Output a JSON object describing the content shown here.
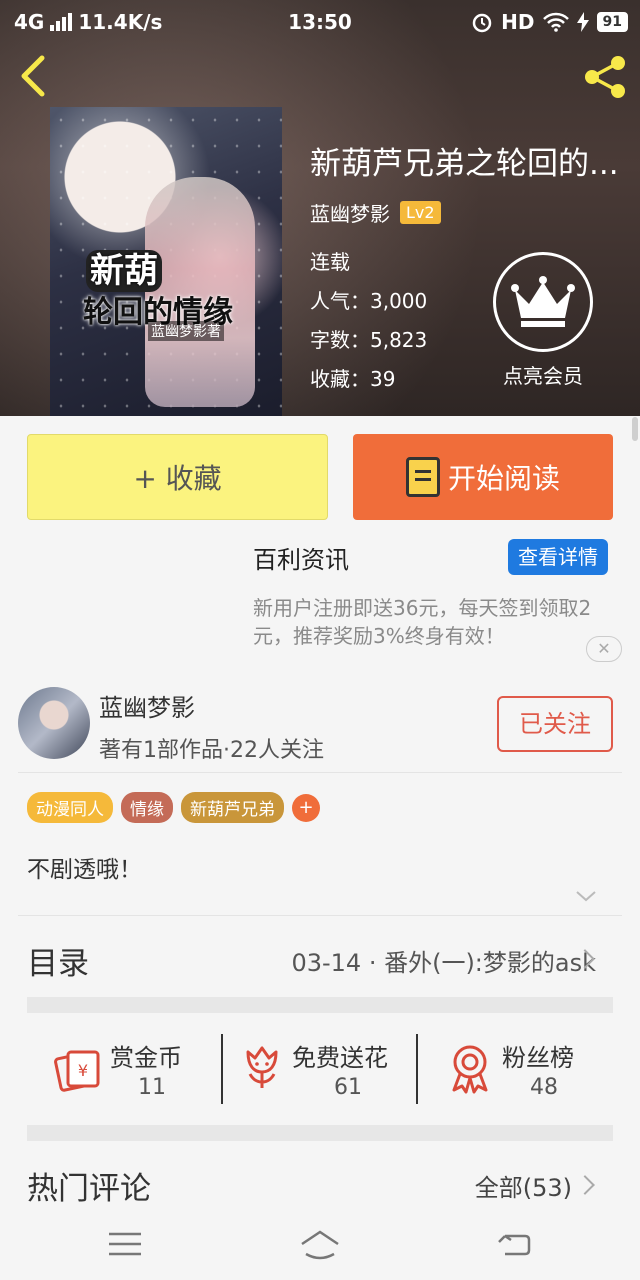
{
  "status_bar": {
    "network": "4G",
    "speed": "11.4K/s",
    "time": "13:50",
    "hd": "HD",
    "battery": "91"
  },
  "book": {
    "title": "新葫芦兄弟之轮回的...",
    "author": "蓝幽梦影",
    "level": "Lv2",
    "status": "连载",
    "popularity": "人气：3,000",
    "word_count": "字数：5,823",
    "favorites": "收藏：39",
    "cover_title_1": "新葫",
    "cover_title_2": "轮回的情缘",
    "cover_author": "蓝幽梦影著"
  },
  "vip": {
    "label": "点亮会员"
  },
  "actions": {
    "collect_label": "+ 收藏",
    "read_label": "开始阅读"
  },
  "ad": {
    "title": "百利资讯",
    "button": "查看详情",
    "description": "新用户注册即送36元，每天签到领取2元，推荐奖励3%终身有效！",
    "close": "✕"
  },
  "author_card": {
    "name": "蓝幽梦影",
    "stats": "著有1部作品·22人关注",
    "follow_label": "已关注"
  },
  "tags": [
    {
      "label": "动漫同人",
      "color": "#f5b93a"
    },
    {
      "label": "情缘",
      "color": "#c46b57"
    },
    {
      "label": "新葫芦兄弟",
      "color": "#c9963a"
    }
  ],
  "tag_add": "+",
  "synopsis": "不剧透哦！",
  "toc": {
    "label": "目录",
    "latest": "03-14 · 番外(一):梦影的ask"
  },
  "stats": [
    {
      "label": "赏金币",
      "value": "11",
      "icon": "red-envelope-icon"
    },
    {
      "label": "免费送花",
      "value": "61",
      "icon": "flower-icon"
    },
    {
      "label": "粉丝榜",
      "value": "48",
      "icon": "ribbon-badge-icon"
    }
  ],
  "comments": {
    "label": "热门评论",
    "all": "全部(53)"
  },
  "colors": {
    "accent_orange": "#f06d3a",
    "collect_yellow": "#fbf37f",
    "ad_blue": "#1f7ae0",
    "follow_red": "#e05a4a",
    "icon_red": "#d84a3a"
  }
}
